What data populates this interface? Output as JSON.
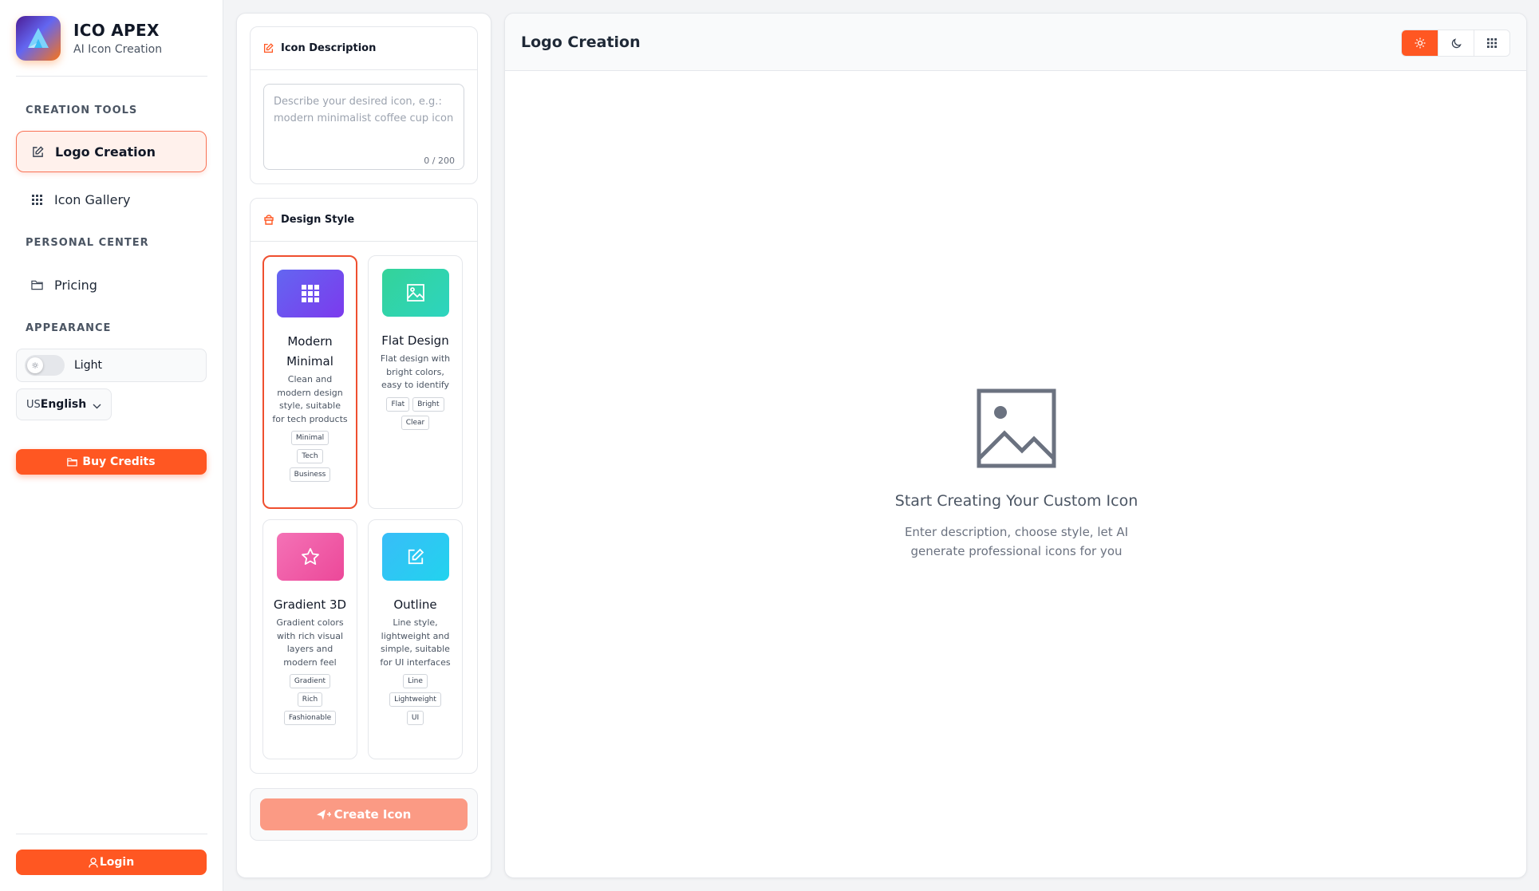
{
  "brand": {
    "title": "ICO APEX",
    "subtitle": "AI Icon Creation"
  },
  "sidebar": {
    "sections": {
      "creation_tools": "CREATION TOOLS",
      "personal_center": "PERSONAL CENTER",
      "appearance": "APPEARANCE"
    },
    "items": [
      {
        "label": "Logo Creation",
        "icon": "edit-icon",
        "active": true
      },
      {
        "label": "Icon Gallery",
        "icon": "grid-icon",
        "active": false
      },
      {
        "label": "Pricing",
        "icon": "folder-icon",
        "active": false
      }
    ],
    "theme": {
      "label": "Light",
      "icon": "sun-icon"
    },
    "language": {
      "code": "US",
      "name": "English"
    },
    "buy_credits": "Buy Credits",
    "login": "Login"
  },
  "description_card": {
    "title": "Icon Description",
    "placeholder": "Describe your desired icon, e.g.: modern minimalist coffee cup icon",
    "value": "",
    "char_count": "0 / 200"
  },
  "style_card": {
    "title": "Design Style",
    "styles": [
      {
        "name": "Modern Minimal",
        "desc": "Clean and modern design style, suitable for tech products",
        "tags": [
          "Minimal",
          "Tech",
          "Business"
        ],
        "icon": "grid-icon",
        "selected": true
      },
      {
        "name": "Flat Design",
        "desc": "Flat design with bright colors, easy to identify",
        "tags": [
          "Flat",
          "Bright",
          "Clear"
        ],
        "icon": "image-icon",
        "selected": false
      },
      {
        "name": "Gradient 3D",
        "desc": "Gradient colors with rich visual layers and modern feel",
        "tags": [
          "Gradient",
          "Rich",
          "Fashionable"
        ],
        "icon": "star-icon",
        "selected": false
      },
      {
        "name": "Outline",
        "desc": "Line style, lightweight and simple, suitable for UI interfaces",
        "tags": [
          "Line",
          "Lightweight",
          "UI"
        ],
        "icon": "edit-icon",
        "selected": false
      }
    ]
  },
  "create_button": "Create Icon",
  "main": {
    "title": "Logo Creation",
    "empty_title": "Start Creating Your Custom Icon",
    "empty_desc": "Enter description, choose style, let AI generate professional icons for you"
  },
  "colors": {
    "accent": "#ff5722",
    "accent_light": "#fb9a84",
    "selected_border": "#ef4f2f"
  }
}
